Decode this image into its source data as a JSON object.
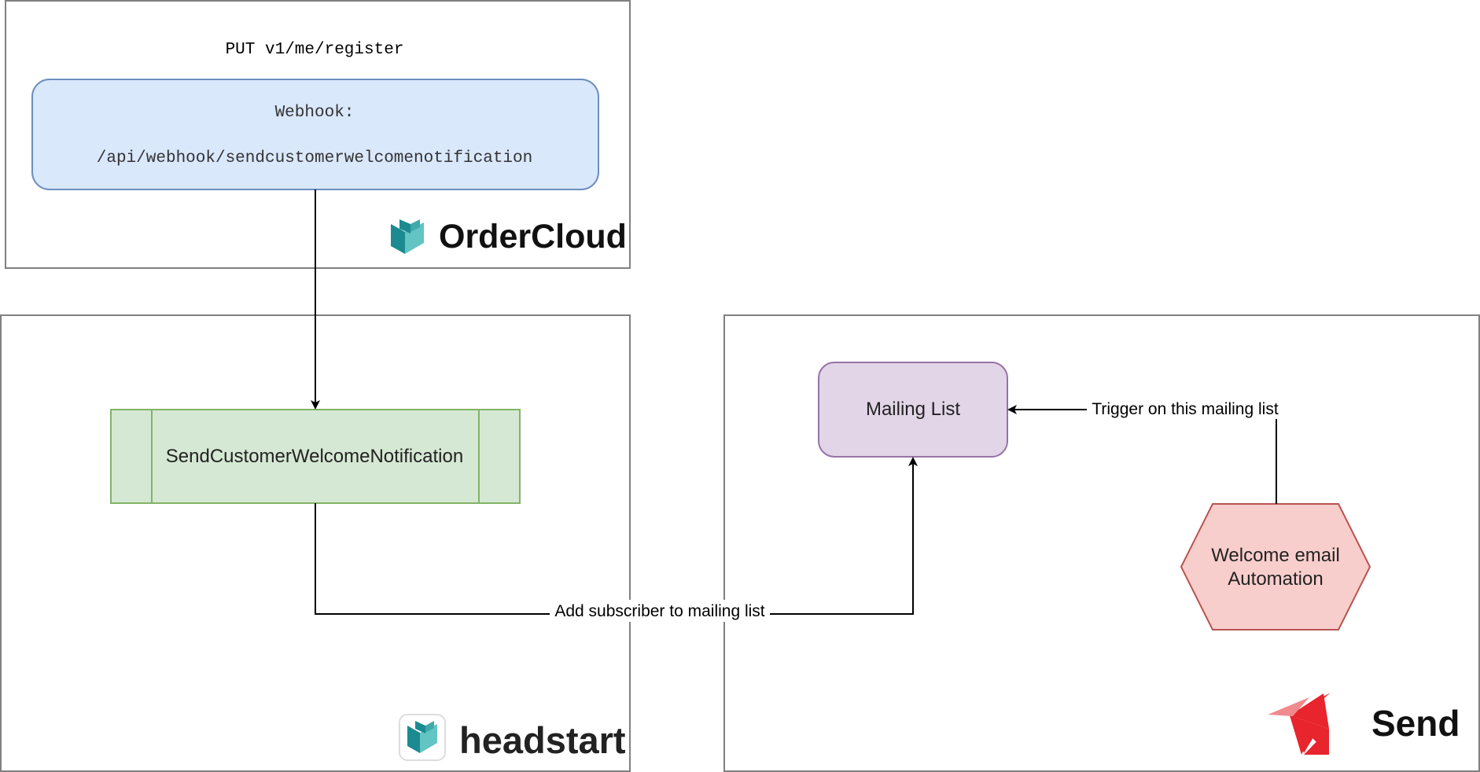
{
  "ordercloud_panel": {
    "endpoint": "PUT v1/me/register",
    "webhook_label": "Webhook:",
    "webhook_path": "/api/webhook/sendcustomerwelcomenotification",
    "logo_text": "OrderCloud"
  },
  "headstart_panel": {
    "function_label": "SendCustomerWelcomeNotification",
    "logo_text": "headstart"
  },
  "send_panel": {
    "mailing_list_label": "Mailing List",
    "automation_label_line1": "Welcome email",
    "automation_label_line2": "Automation",
    "logo_text": "Send"
  },
  "edges": {
    "add_subscriber_label": "Add subscriber to mailing list",
    "trigger_label": "Trigger on this mailing list"
  },
  "colors": {
    "webhook_fill": "#dae8fc",
    "webhook_stroke": "#6c8ebf",
    "function_fill": "#d5e8d4",
    "function_stroke": "#82b366",
    "mailing_fill": "#e1d5e7",
    "mailing_stroke": "#9673a6",
    "automation_fill": "#f8cecc",
    "automation_stroke": "#b85450",
    "container_stroke": "#808080",
    "teal_dark": "#1b8a91",
    "teal_light": "#62c4c3",
    "send_red": "#e8242c",
    "send_pink": "#f08a8e"
  }
}
